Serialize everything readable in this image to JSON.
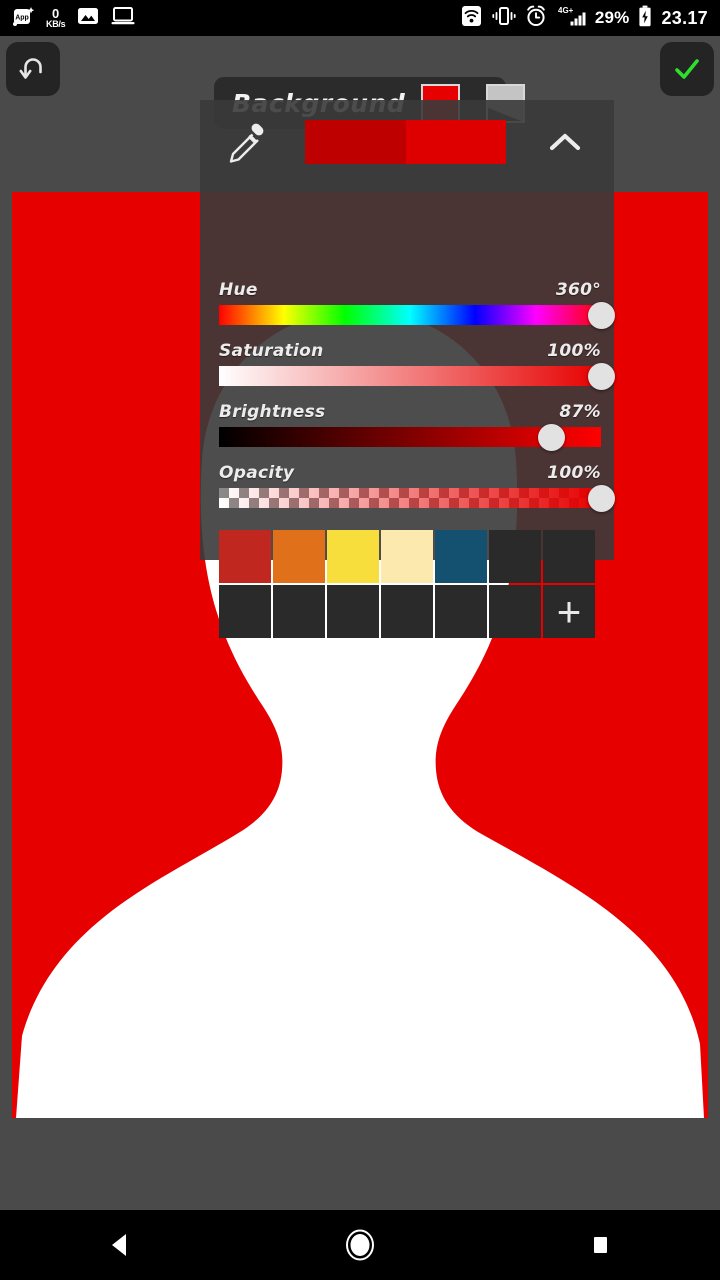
{
  "status_bar": {
    "left_icons": [
      {
        "name": "app-notification-icon",
        "label": "App"
      },
      {
        "name": "network-speed-indicator",
        "value": "0",
        "unit": "KB/s"
      },
      {
        "name": "gallery-image-icon"
      },
      {
        "name": "screencast-laptop-icon"
      }
    ],
    "right_icons": [
      {
        "name": "wifi-icon"
      },
      {
        "name": "vibrate-mode-icon"
      },
      {
        "name": "alarm-clock-icon"
      },
      {
        "name": "mobile-signal-icon",
        "network_label": "4G+"
      }
    ],
    "battery_percent": "29%",
    "battery_state": "charging",
    "time": "23.17"
  },
  "toolbar": {
    "undo_label": "Undo",
    "confirm_label": "Confirm",
    "title": "Background",
    "current_color": "#E60000",
    "layer_thumb_label": "Layer thumbnail"
  },
  "color_panel": {
    "eyedropper_label": "Color picker",
    "collapse_label": "Collapse panel",
    "old_color": "#BE0000",
    "new_color": "#DE0000",
    "sliders": [
      {
        "name": "hue",
        "label": "Hue",
        "value": "360°",
        "percent": 100
      },
      {
        "name": "saturation",
        "label": "Saturation",
        "value": "100%",
        "percent": 100
      },
      {
        "name": "brightness",
        "label": "Brightness",
        "value": "87%",
        "percent": 87
      },
      {
        "name": "opacity",
        "label": "Opacity",
        "value": "100%",
        "percent": 100
      }
    ],
    "palette": {
      "add_label": "+",
      "swatches": [
        "#C0281F",
        "#E0701A",
        "#F8DE3C",
        "#FBE9AE",
        "#145070",
        null,
        null,
        null,
        null,
        null,
        null,
        null,
        null,
        null
      ]
    }
  },
  "canvas": {
    "background_color": "#E60000",
    "silhouette_color": "#FFFFFF",
    "description": "Portrait silhouette"
  },
  "nav_bar": {
    "back_label": "Back",
    "home_label": "Home",
    "recents_label": "Recents"
  }
}
